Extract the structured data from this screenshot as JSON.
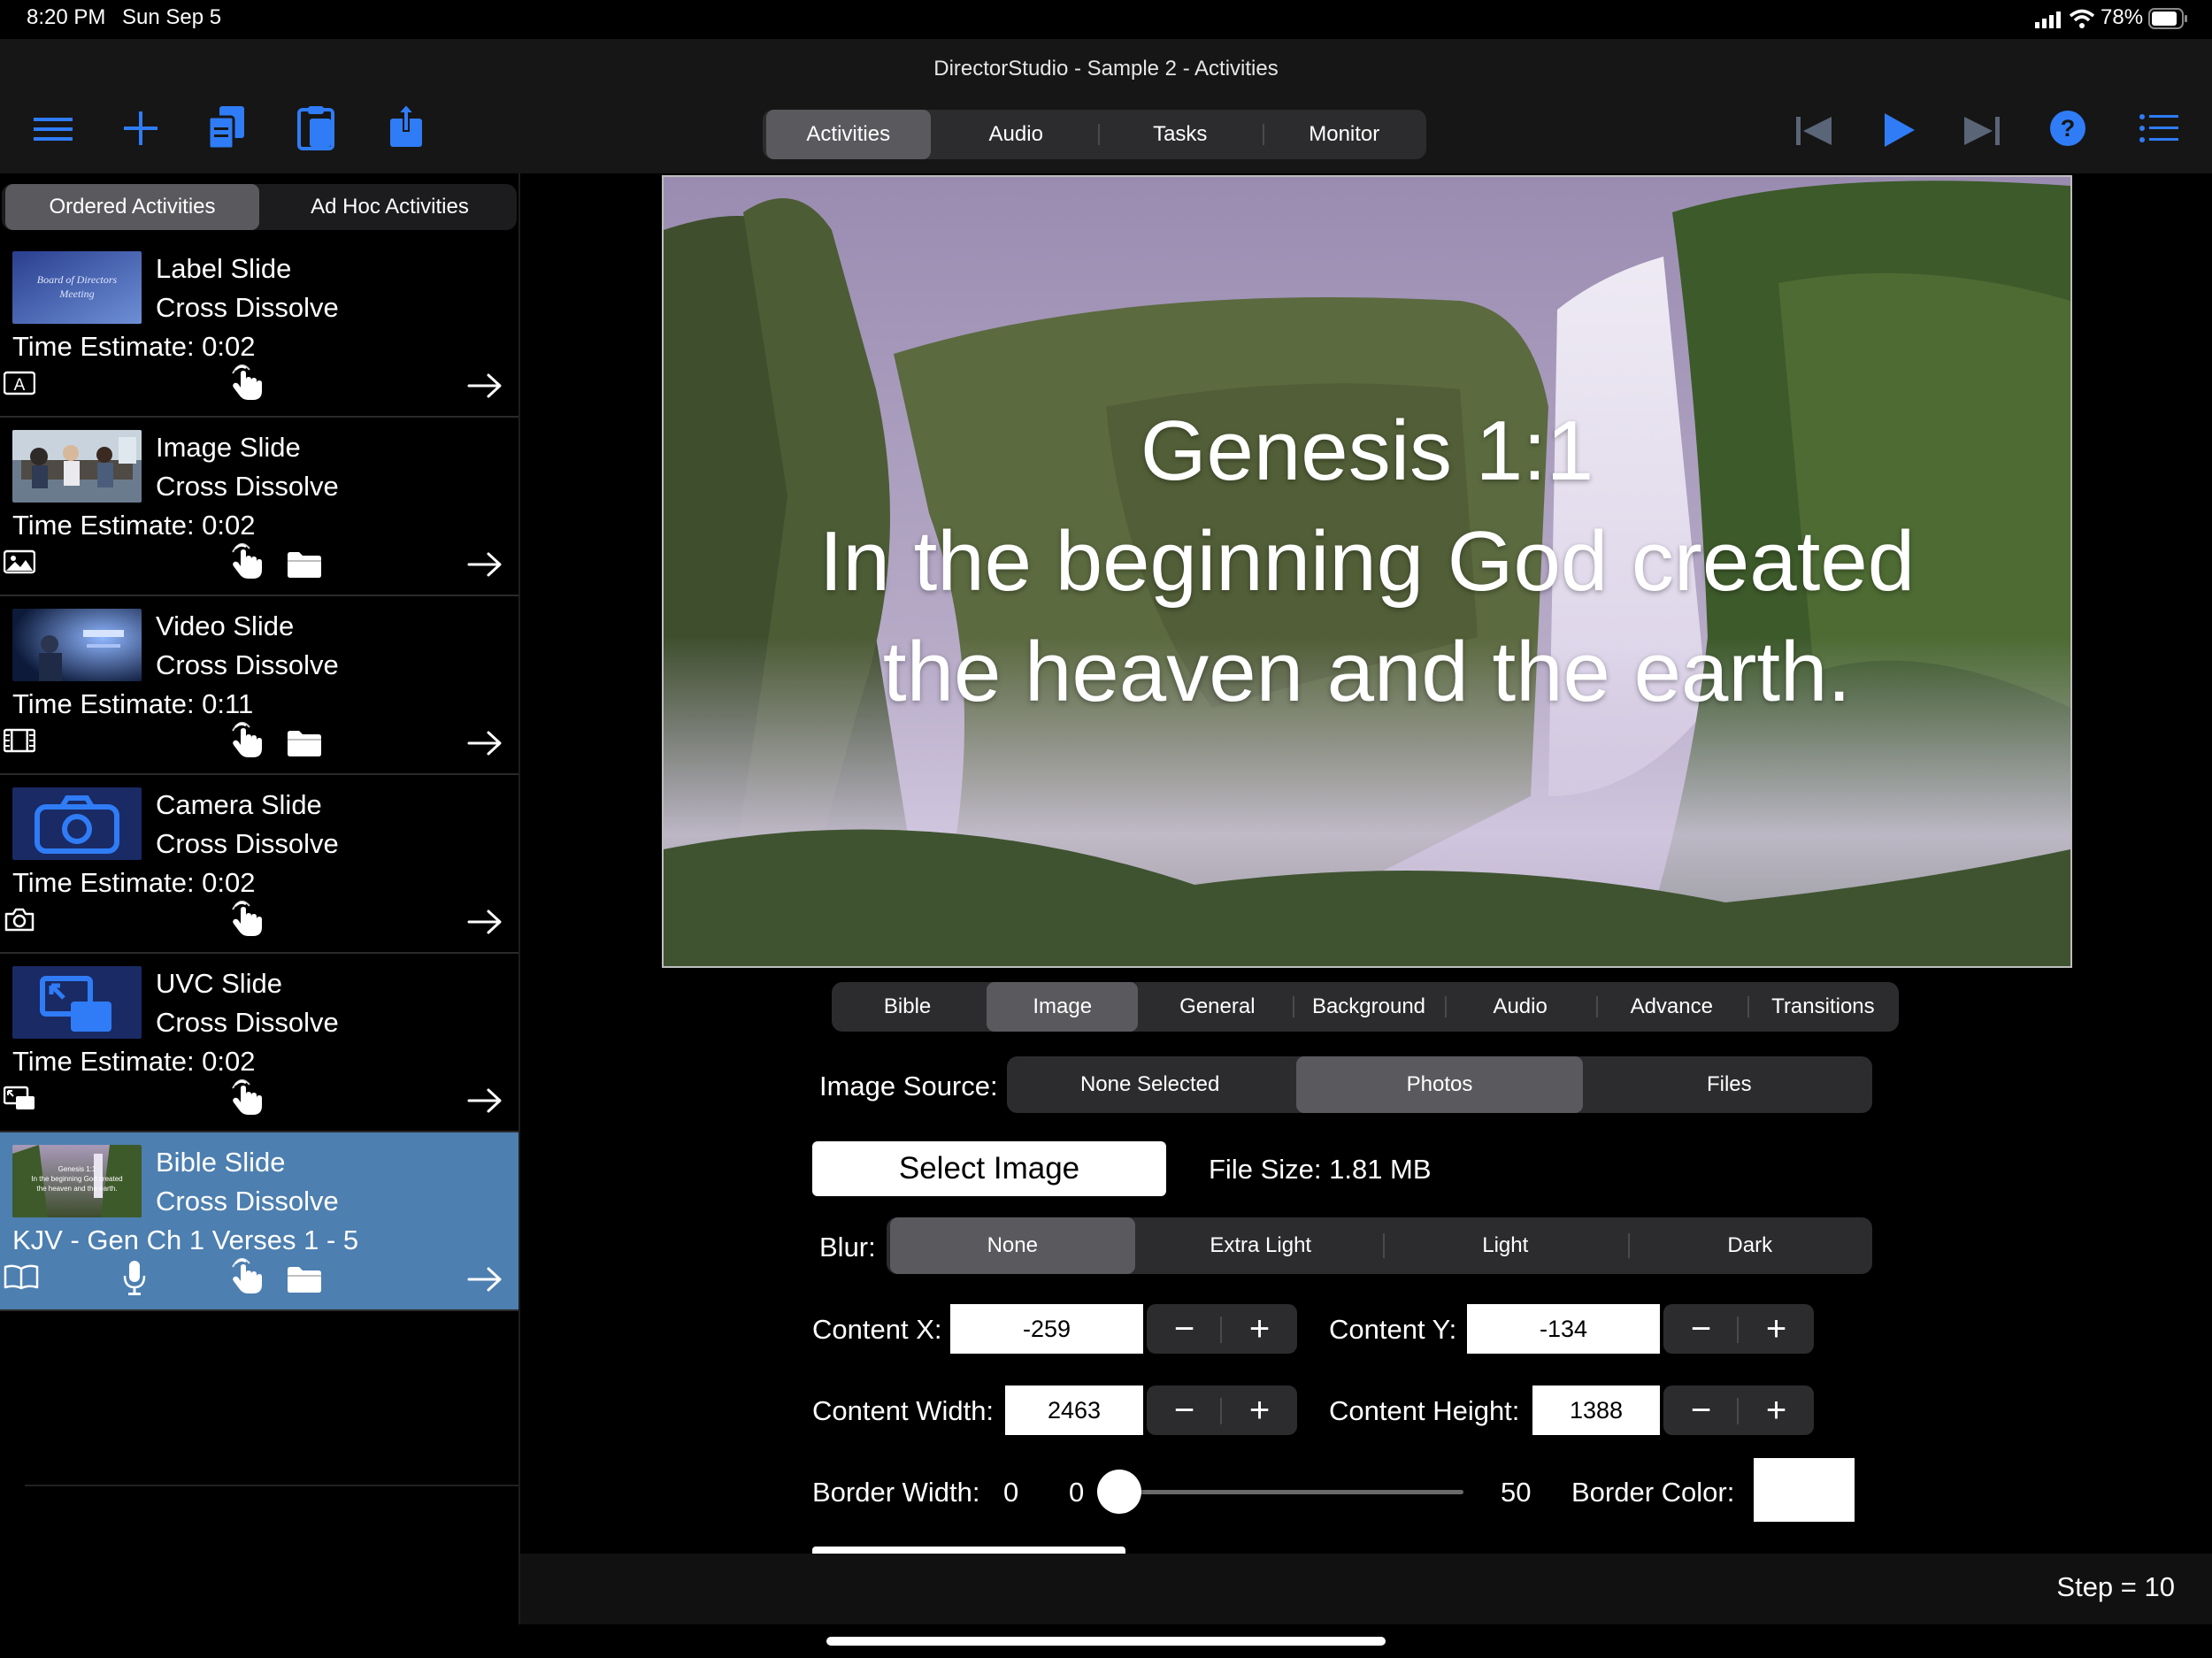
{
  "status_bar": {
    "time": "8:20 PM",
    "date": "Sun Sep 5",
    "battery": "78%"
  },
  "window": {
    "title": "DirectorStudio - Sample 2 - Activities"
  },
  "toolbar": {
    "left_icons": [
      "menu-icon",
      "plus-icon",
      "copy-icon",
      "paste-icon",
      "share-icon"
    ],
    "right_icons": [
      "skip-back-icon",
      "play-icon",
      "skip-forward-icon",
      "help-icon",
      "list-icon"
    ],
    "tabs": [
      {
        "label": "Activities",
        "selected": true
      },
      {
        "label": "Audio",
        "selected": false
      },
      {
        "label": "Tasks",
        "selected": false
      },
      {
        "label": "Monitor",
        "selected": false
      }
    ]
  },
  "sidebar": {
    "tabs": [
      {
        "label": "Ordered Activities",
        "selected": true
      },
      {
        "label": "Ad Hoc Activities",
        "selected": false
      }
    ],
    "items": [
      {
        "title": "Label Slide",
        "transition": "Cross Dissolve",
        "estimate": "Time Estimate: 0:02",
        "thumb_text": "Board of Directors Meeting",
        "type_icon": "label-icon",
        "has_folder": false,
        "has_mic": false
      },
      {
        "title": "Image Slide",
        "transition": "Cross Dissolve",
        "estimate": "Time Estimate: 0:02",
        "type_icon": "image-icon",
        "has_folder": true,
        "has_mic": false
      },
      {
        "title": "Video Slide",
        "transition": "Cross Dissolve",
        "estimate": "Time Estimate: 0:11",
        "type_icon": "film-icon",
        "has_folder": true,
        "has_mic": false
      },
      {
        "title": "Camera Slide",
        "transition": "Cross Dissolve",
        "estimate": "Time Estimate: 0:02",
        "type_icon": "camera-icon",
        "has_folder": false,
        "has_mic": false
      },
      {
        "title": "UVC Slide",
        "transition": "Cross Dissolve",
        "estimate": "Time Estimate: 0:02",
        "type_icon": "uvc-icon",
        "has_folder": false,
        "has_mic": false
      },
      {
        "title": "Bible Slide",
        "transition": "Cross Dissolve",
        "estimate": "KJV - Gen Ch 1 Verses 1 - 5",
        "type_icon": "book-icon",
        "has_folder": true,
        "has_mic": true,
        "selected": true,
        "thumb_text": "Genesis 1:1 In the beginning God created the heaven and the earth."
      }
    ]
  },
  "preview": {
    "lines": [
      "Genesis 1:1",
      "In the beginning God created",
      "the heaven and the earth."
    ]
  },
  "editor": {
    "tabs": [
      {
        "label": "Bible",
        "selected": false
      },
      {
        "label": "Image",
        "selected": true
      },
      {
        "label": "General",
        "selected": false
      },
      {
        "label": "Background",
        "selected": false
      },
      {
        "label": "Audio",
        "selected": false
      },
      {
        "label": "Advance",
        "selected": false
      },
      {
        "label": "Transitions",
        "selected": false
      }
    ],
    "image_source_label": "Image Source:",
    "image_source_options": [
      {
        "label": "None Selected",
        "selected": false
      },
      {
        "label": "Photos",
        "selected": true
      },
      {
        "label": "Files",
        "selected": false
      }
    ],
    "select_image_label": "Select Image",
    "file_size": "File Size: 1.81 MB",
    "blur_label": "Blur:",
    "blur_options": [
      {
        "label": "None",
        "selected": true
      },
      {
        "label": "Extra Light",
        "selected": false
      },
      {
        "label": "Light",
        "selected": false
      },
      {
        "label": "Dark",
        "selected": false
      }
    ],
    "content_x_label": "Content X:",
    "content_x": "-259",
    "content_y_label": "Content Y:",
    "content_y": "-134",
    "content_width_label": "Content Width:",
    "content_width": "2463",
    "content_height_label": "Content Height:",
    "content_height": "1388",
    "border_width_label": "Border Width:",
    "border_width_value": "0",
    "slider_min": "0",
    "slider_max": "50",
    "slider_fraction": 0,
    "border_color_label": "Border Color:",
    "border_color": "#ffffff"
  },
  "footer": {
    "step": "Step = 10"
  },
  "colors": {
    "accent": "#2f7cf6",
    "selected_row": "#4d7fb0"
  }
}
